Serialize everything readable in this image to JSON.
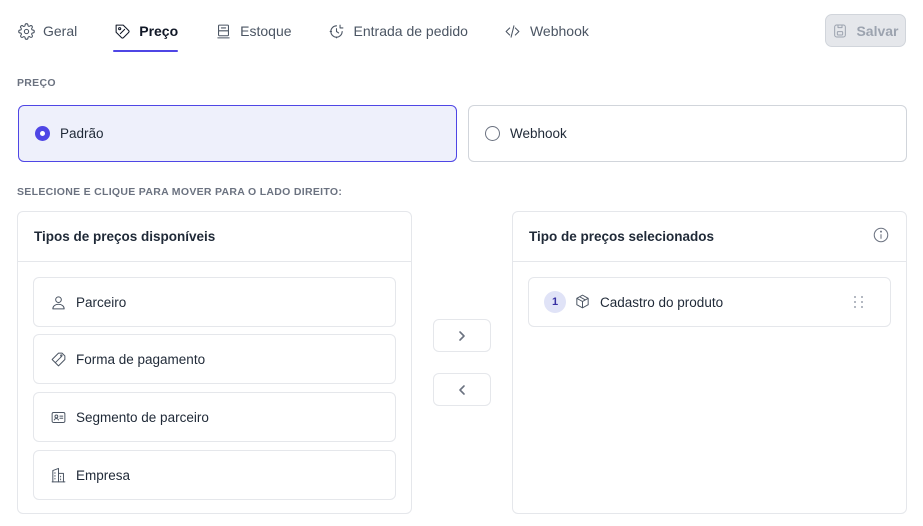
{
  "tabs": [
    {
      "label": "Geral",
      "icon": "gear-icon"
    },
    {
      "label": "Preço",
      "icon": "tag-icon",
      "active": true
    },
    {
      "label": "Estoque",
      "icon": "box-stack-icon"
    },
    {
      "label": "Entrada de pedido",
      "icon": "order-entry-icon"
    },
    {
      "label": "Webhook",
      "icon": "code-icon"
    }
  ],
  "save_button": {
    "label": "Salvar",
    "icon": "save-icon",
    "disabled": true
  },
  "price_section": {
    "label": "PREÇO",
    "options": [
      {
        "label": "Padrão",
        "selected": true
      },
      {
        "label": "Webhook",
        "selected": false
      }
    ]
  },
  "move_section": {
    "label": "SELECIONE E CLIQUE PARA MOVER PARA O LADO DIREITO:"
  },
  "available_panel": {
    "title": "Tipos de preços disponíveis",
    "items": [
      {
        "label": "Parceiro",
        "icon": "user-icon"
      },
      {
        "label": "Forma de pagamento",
        "icon": "ticket-icon"
      },
      {
        "label": "Segmento de parceiro",
        "icon": "id-card-icon"
      },
      {
        "label": "Empresa",
        "icon": "building-icon"
      }
    ]
  },
  "selected_panel": {
    "title": "Tipo de preços selecionados",
    "items": [
      {
        "index": "1",
        "label": "Cadastro do produto",
        "icon": "cube-icon"
      }
    ]
  },
  "colors": {
    "accent": "#4f46e5",
    "selected_bg": "#eef0fb"
  }
}
